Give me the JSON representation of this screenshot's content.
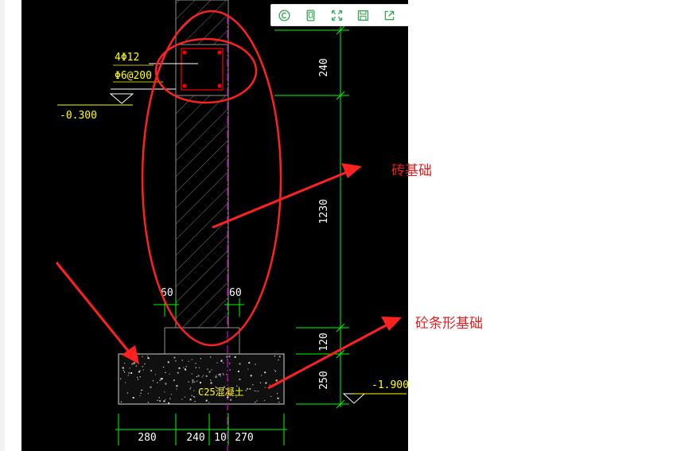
{
  "toolbar": {
    "buttons": [
      {
        "name": "copyright-icon"
      },
      {
        "name": "tablet-icon"
      },
      {
        "name": "expand-icon"
      },
      {
        "name": "save-icon"
      },
      {
        "name": "share-icon"
      },
      {
        "name": "gear-icon"
      }
    ]
  },
  "drawing": {
    "rebar_main": "4Φ12",
    "rebar_stirrup": "Φ6@200",
    "elev_top": "-0.300",
    "elev_bottom": "-1.900",
    "concrete_label": "C25混凝土",
    "dims_vertical": [
      "240",
      "1230",
      "120",
      "250"
    ],
    "dim_offset_left": "60",
    "dim_offset_right": "60",
    "dims_bottom": [
      "280",
      "240",
      "10",
      "270"
    ]
  },
  "annotations": {
    "brick_foundation": "砖基础",
    "strip_foundation": "砼条形基础"
  },
  "colors": {
    "dim_green": "#00ff00",
    "text_yellow": "#ffff00",
    "annotation_red": "#ff2020",
    "wall_grey": "#909090",
    "rebar_red": "#ff0000",
    "axis_magenta": "#d000d0"
  }
}
